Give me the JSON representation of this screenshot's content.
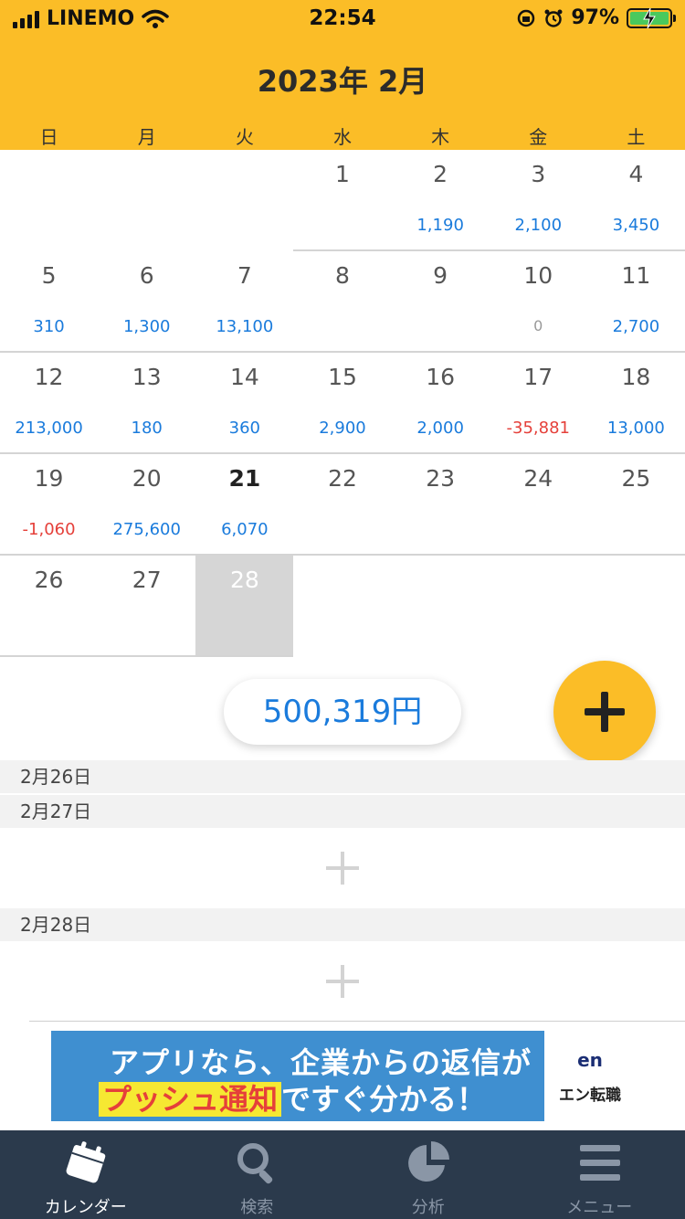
{
  "status_bar": {
    "carrier": "LINEMO",
    "time": "22:54",
    "battery": "97%"
  },
  "header": {
    "month_title": "2023年 2月",
    "weekdays": [
      "日",
      "月",
      "火",
      "水",
      "木",
      "金",
      "土"
    ]
  },
  "calendar": {
    "weeks": [
      [
        {
          "day": "",
          "amount": ""
        },
        {
          "day": "",
          "amount": ""
        },
        {
          "day": "",
          "amount": ""
        },
        {
          "day": "1",
          "amount": ""
        },
        {
          "day": "2",
          "amount": "1,190"
        },
        {
          "day": "3",
          "amount": "2,100"
        },
        {
          "day": "4",
          "amount": "3,450"
        }
      ],
      [
        {
          "day": "5",
          "amount": "310"
        },
        {
          "day": "6",
          "amount": "1,300"
        },
        {
          "day": "7",
          "amount": "13,100"
        },
        {
          "day": "8",
          "amount": ""
        },
        {
          "day": "9",
          "amount": ""
        },
        {
          "day": "10",
          "amount": "0"
        },
        {
          "day": "11",
          "amount": "2,700"
        }
      ],
      [
        {
          "day": "12",
          "amount": "213,000"
        },
        {
          "day": "13",
          "amount": "180"
        },
        {
          "day": "14",
          "amount": "360"
        },
        {
          "day": "15",
          "amount": "2,900"
        },
        {
          "day": "16",
          "amount": "2,000"
        },
        {
          "day": "17",
          "amount": "-35,881"
        },
        {
          "day": "18",
          "amount": "13,000"
        }
      ],
      [
        {
          "day": "19",
          "amount": "-1,060"
        },
        {
          "day": "20",
          "amount": "275,600"
        },
        {
          "day": "21",
          "amount": "6,070"
        },
        {
          "day": "22",
          "amount": ""
        },
        {
          "day": "23",
          "amount": ""
        },
        {
          "day": "24",
          "amount": ""
        },
        {
          "day": "25",
          "amount": ""
        }
      ],
      [
        {
          "day": "26",
          "amount": ""
        },
        {
          "day": "27",
          "amount": ""
        },
        {
          "day": "28",
          "amount": ""
        },
        {
          "day": "",
          "amount": ""
        },
        {
          "day": "",
          "amount": ""
        },
        {
          "day": "",
          "amount": ""
        },
        {
          "day": "",
          "amount": ""
        }
      ]
    ],
    "today": "21",
    "selected": "28"
  },
  "total": "500,319円",
  "day_list": [
    {
      "date": "2月26日"
    },
    {
      "date": "2月27日"
    },
    {
      "date": "2月28日"
    }
  ],
  "ad": {
    "line1": "アプリなら、企業からの返信が",
    "line2_highlight": "プッシュ通知",
    "line2_rest": "ですぐ分かる！",
    "logo": "en",
    "brand": "エン転職"
  },
  "tabs": [
    {
      "label": "カレンダー",
      "icon": "calendar-icon"
    },
    {
      "label": "検索",
      "icon": "search-icon"
    },
    {
      "label": "分析",
      "icon": "pie-chart-icon"
    },
    {
      "label": "メニュー",
      "icon": "menu-icon"
    }
  ],
  "colors": {
    "accent": "#fbbd27",
    "positive": "#1a7bdc",
    "negative": "#e5403a",
    "tabbar": "#2b3a4c"
  }
}
